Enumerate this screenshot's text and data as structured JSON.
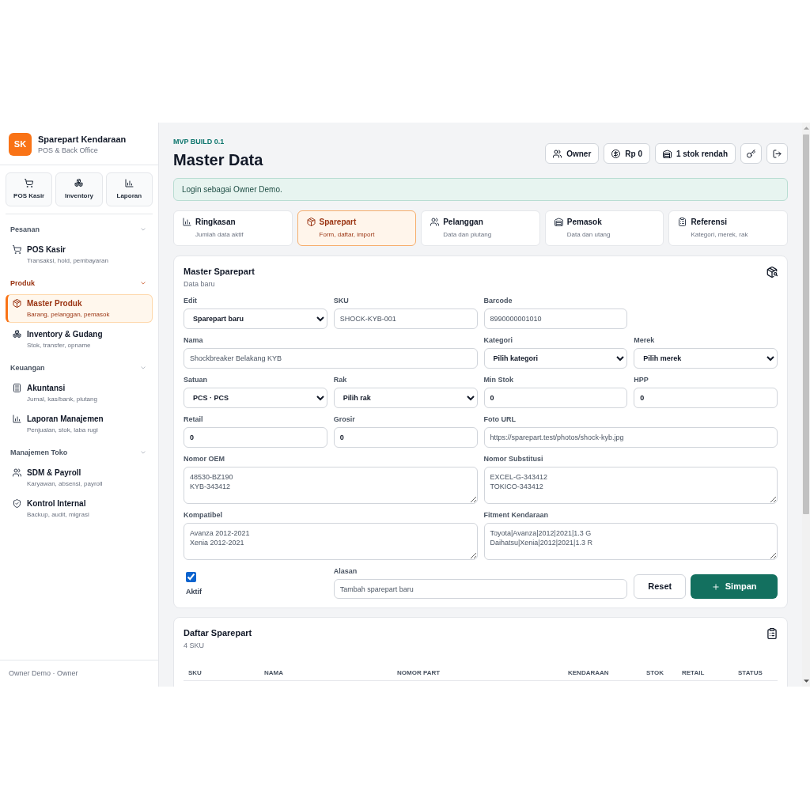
{
  "sidebar": {
    "logo": "SK",
    "title": "Sparepart Kendaraan",
    "subtitle": "POS & Back Office",
    "quick_actions": [
      "POS Kasir",
      "Inventory",
      "Laporan"
    ],
    "sections": [
      {
        "title": "Pesanan",
        "expanded": true,
        "items": [
          {
            "title": "POS Kasir",
            "subtitle": "Transaksi, hold, pembayaran",
            "selected": false
          }
        ]
      },
      {
        "title": "Produk",
        "expanded": true,
        "items": [
          {
            "title": "Master Produk",
            "subtitle": "Barang, pelanggan, pemasok",
            "selected": true
          },
          {
            "title": "Inventory & Gudang",
            "subtitle": "Stok, transfer, opname",
            "selected": false
          }
        ]
      },
      {
        "title": "Keuangan",
        "expanded": true,
        "items": [
          {
            "title": "Akuntansi",
            "subtitle": "Jurnal, kas/bank, piutang",
            "selected": false
          },
          {
            "title": "Laporan Manajemen",
            "subtitle": "Penjualan, stok, laba rugi",
            "selected": false
          }
        ]
      },
      {
        "title": "Manajemen Toko",
        "expanded": true,
        "items": [
          {
            "title": "SDM & Payroll",
            "subtitle": "Karyawan, absensi, payroll",
            "selected": false
          },
          {
            "title": "Kontrol Internal",
            "subtitle": "Backup, audit, migrasi",
            "selected": false
          }
        ]
      }
    ],
    "footer": "Owner Demo · Owner"
  },
  "header": {
    "eyebrow": "MVP BUILD 0.1",
    "title": "Master Data",
    "actions": [
      "Owner",
      "Rp 0",
      "1 stok rendah"
    ]
  },
  "alert": "Login sebagai Owner Demo.",
  "tabs": [
    {
      "title": "Ringkasan",
      "subtitle": "Jumlah data aktif",
      "selected": false
    },
    {
      "title": "Sparepart",
      "subtitle": "Form, daftar, import",
      "selected": true
    },
    {
      "title": "Pelanggan",
      "subtitle": "Data dan piutang",
      "selected": false
    },
    {
      "title": "Pemasok",
      "subtitle": "Data dan utang",
      "selected": false
    },
    {
      "title": "Referensi",
      "subtitle": "Kategori, merek, rak",
      "selected": false
    }
  ],
  "form": {
    "title": "Master Sparepart",
    "subtitle": "Data baru",
    "fields": [
      {
        "kind": "select",
        "label": "Edit",
        "value": "Sparepart baru"
      },
      {
        "kind": "input",
        "label": "SKU",
        "placeholder": "SHOCK-KYB-001"
      },
      {
        "kind": "input",
        "label": "Barcode",
        "placeholder": "8990000001010"
      },
      {
        "kind": "input",
        "label": "Nama",
        "placeholder": "Shockbreaker Belakang KYB"
      },
      {
        "kind": "select",
        "label": "Kategori",
        "value": "Pilih kategori"
      },
      {
        "kind": "select",
        "label": "Merek",
        "value": "Pilih merek"
      },
      {
        "kind": "select",
        "label": "Satuan",
        "value": "PCS · PCS"
      },
      {
        "kind": "select",
        "label": "Rak",
        "value": "Pilih rak"
      },
      {
        "kind": "input",
        "label": "Min Stok",
        "value": "0"
      },
      {
        "kind": "input",
        "label": "HPP",
        "value": "0"
      },
      {
        "kind": "input",
        "label": "Retail",
        "value": "0"
      },
      {
        "kind": "input",
        "label": "Grosir",
        "value": "0"
      },
      {
        "kind": "input",
        "label": "Foto URL",
        "placeholder": "https://sparepart.test/photos/shock-kyb.jpg"
      },
      {
        "kind": "textarea",
        "label": "Nomor OEM",
        "placeholder": "48530-BZ190\nKYB-343412"
      },
      {
        "kind": "textarea",
        "label": "Nomor Substitusi",
        "placeholder": "EXCEL-G-343412\nTOKICO-343412"
      },
      {
        "kind": "textarea",
        "label": "Kompatibel",
        "placeholder": "Avanza 2012-2021\nXenia 2012-2021"
      },
      {
        "kind": "textarea",
        "label": "Fitment Kendaraan",
        "placeholder": "Toyota|Avanza|2012|2021|1.3 G\nDaihatsu|Xenia|2012|2021|1.3 R"
      }
    ],
    "active": {
      "label": "Aktif",
      "checked": true
    },
    "reason": {
      "label": "Alasan",
      "placeholder": "Tambah sparepart baru"
    },
    "buttons": [
      {
        "kind": "secondary",
        "label": "Reset"
      },
      {
        "kind": "primary",
        "label": "Simpan"
      }
    ]
  },
  "list": {
    "title": "Daftar Sparepart",
    "subtitle": "4 SKU",
    "columns": [
      "SKU",
      "NAMA",
      "NOMOR PART",
      "KENDARAAN",
      "STOK",
      "RETAIL",
      "STATUS"
    ]
  }
}
